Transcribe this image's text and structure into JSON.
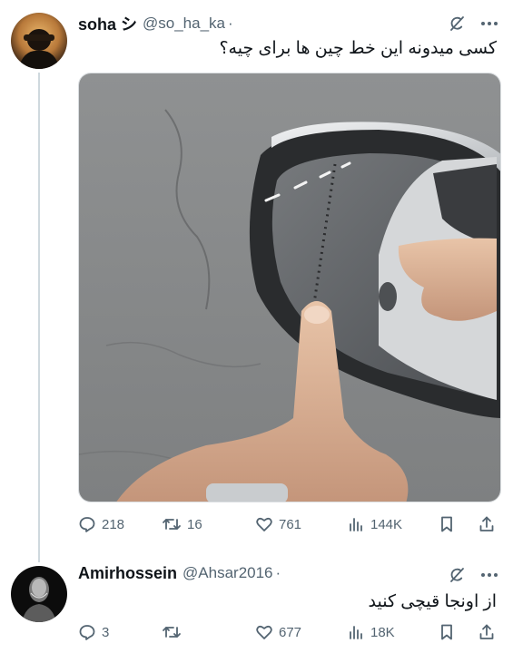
{
  "tweets": [
    {
      "author_name": "soha シ",
      "handle": "@so_ha_ka",
      "separator": "·",
      "text": "کسی میدونه این خط چین ها برای چیه؟",
      "media_icon": "car-side-mirror-photo",
      "stats": {
        "replies": "218",
        "reposts": "16",
        "likes": "761",
        "views": "144K"
      }
    },
    {
      "author_name": "Amirhossein",
      "handle": "@Ahsar2016",
      "separator": "·",
      "text": "از اونجا قیچی کنید",
      "stats": {
        "replies": "3",
        "reposts": "",
        "likes": "677",
        "views": "18K"
      }
    }
  ],
  "icons": {
    "reply": "reply-icon",
    "repost": "repost-icon",
    "like": "heart-icon",
    "views": "views-icon",
    "bookmark": "bookmark-icon",
    "share": "share-icon",
    "grok": "grok-icon",
    "more": "more-icon"
  },
  "colors": {
    "text": "#0f1419",
    "secondary": "#536471",
    "divider": "#cfd9de"
  }
}
